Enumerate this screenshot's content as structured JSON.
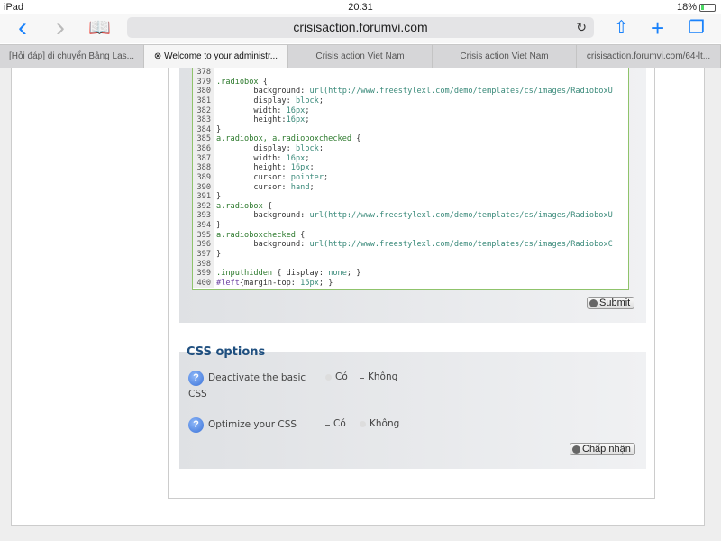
{
  "status": {
    "device": "iPad",
    "time": "20:31",
    "battery": "18%",
    "battery_level": 0.18
  },
  "toolbar": {
    "url": "crisisaction.forumvi.com",
    "back_icon": "‹",
    "forward_icon": "›"
  },
  "tabs": [
    {
      "label": "[Hỏi đáp] di chuyển Bảng Las..."
    },
    {
      "label": "Welcome to your administr...",
      "active": true
    },
    {
      "label": "Crisis action Viet Nam"
    },
    {
      "label": "Crisis action Viet Nam"
    },
    {
      "label": "crisisaction.forumvi.com/64-lt..."
    }
  ],
  "code": {
    "lines": [
      {
        "num": "378",
        "tokens": []
      },
      {
        "num": "379",
        "tokens": [
          [
            "sel",
            ".radiobox"
          ],
          [
            "txt",
            " {"
          ]
        ]
      },
      {
        "num": "380",
        "tokens": [
          [
            "txt",
            "        background: "
          ],
          [
            "val",
            "url(http://www.freestylexl.com/demo/templates/cs/images/RadioboxU"
          ]
        ]
      },
      {
        "num": "381",
        "tokens": [
          [
            "txt",
            "        display: "
          ],
          [
            "val",
            "block"
          ],
          [
            "txt",
            ";"
          ]
        ]
      },
      {
        "num": "382",
        "tokens": [
          [
            "txt",
            "        width: "
          ],
          [
            "val",
            "16px"
          ],
          [
            "txt",
            ";"
          ]
        ]
      },
      {
        "num": "383",
        "tokens": [
          [
            "txt",
            "        height:"
          ],
          [
            "val",
            "16px"
          ],
          [
            "txt",
            ";"
          ]
        ]
      },
      {
        "num": "384",
        "tokens": [
          [
            "txt",
            "}"
          ]
        ]
      },
      {
        "num": "385",
        "tokens": [
          [
            "sel",
            "a.radiobox, a.radioboxchecked"
          ],
          [
            "txt",
            " {"
          ]
        ]
      },
      {
        "num": "386",
        "tokens": [
          [
            "txt",
            "        display: "
          ],
          [
            "val",
            "block"
          ],
          [
            "txt",
            ";"
          ]
        ]
      },
      {
        "num": "387",
        "tokens": [
          [
            "txt",
            "        width: "
          ],
          [
            "val",
            "16px"
          ],
          [
            "txt",
            ";"
          ]
        ]
      },
      {
        "num": "388",
        "tokens": [
          [
            "txt",
            "        height: "
          ],
          [
            "val",
            "16px"
          ],
          [
            "txt",
            ";"
          ]
        ]
      },
      {
        "num": "389",
        "tokens": [
          [
            "txt",
            "        cursor: "
          ],
          [
            "val",
            "pointer"
          ],
          [
            "txt",
            ";"
          ]
        ]
      },
      {
        "num": "390",
        "tokens": [
          [
            "txt",
            "        cursor: "
          ],
          [
            "val",
            "hand"
          ],
          [
            "txt",
            ";"
          ]
        ]
      },
      {
        "num": "391",
        "tokens": [
          [
            "txt",
            "}"
          ]
        ]
      },
      {
        "num": "392",
        "tokens": [
          [
            "sel",
            "a.radiobox"
          ],
          [
            "txt",
            " {"
          ]
        ]
      },
      {
        "num": "393",
        "tokens": [
          [
            "txt",
            "        background: "
          ],
          [
            "val",
            "url(http://www.freestylexl.com/demo/templates/cs/images/RadioboxU"
          ]
        ]
      },
      {
        "num": "394",
        "tokens": [
          [
            "txt",
            "}"
          ]
        ]
      },
      {
        "num": "395",
        "tokens": [
          [
            "sel",
            "a.radioboxchecked"
          ],
          [
            "txt",
            " {"
          ]
        ]
      },
      {
        "num": "396",
        "tokens": [
          [
            "txt",
            "        background: "
          ],
          [
            "val",
            "url(http://www.freestylexl.com/demo/templates/cs/images/RadioboxC"
          ]
        ]
      },
      {
        "num": "397",
        "tokens": [
          [
            "txt",
            "}"
          ]
        ]
      },
      {
        "num": "398",
        "tokens": []
      },
      {
        "num": "399",
        "tokens": [
          [
            "sel",
            ".inputhidden"
          ],
          [
            "txt",
            " { display: "
          ],
          [
            "val",
            "none"
          ],
          [
            "txt",
            "; }"
          ]
        ]
      },
      {
        "num": "400",
        "tokens": [
          [
            "id",
            "#left"
          ],
          [
            "txt",
            "{margin-top: "
          ],
          [
            "val",
            "15px"
          ],
          [
            "txt",
            "; }"
          ]
        ]
      }
    ]
  },
  "submit_label": "Submit",
  "options": {
    "title": "CSS options",
    "rows": [
      {
        "label_line1": "Deactivate the basic",
        "label_line2": "CSS",
        "yes": "Có",
        "no": "Không",
        "selected": "no"
      },
      {
        "label": "Optimize your CSS",
        "yes": "Có",
        "no": "Không",
        "selected": "yes"
      }
    ],
    "help_icon": "?",
    "accept_label": "Chấp nhận"
  }
}
